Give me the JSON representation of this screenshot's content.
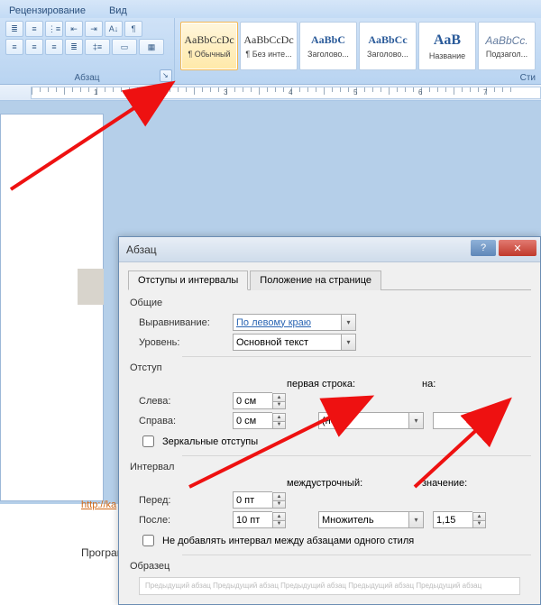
{
  "ribbon": {
    "tabs": {
      "review": "Рецензирование",
      "view": "Вид"
    },
    "paragraph_group_label": "Абзац",
    "styles_label": "Сти",
    "styles": [
      {
        "preview": "AaBbCcDc",
        "name": "¶ Обычный"
      },
      {
        "preview": "AaBbCcDc",
        "name": "¶ Без инте..."
      },
      {
        "preview": "AaBbC",
        "name": "Заголово..."
      },
      {
        "preview": "AaBbCc",
        "name": "Заголово..."
      },
      {
        "preview": "AaB",
        "name": "Название"
      },
      {
        "preview": "AaBbCc.",
        "name": "Подзагол..."
      }
    ]
  },
  "doc": {
    "link": "http://ka",
    "program": "Програм"
  },
  "dialog": {
    "title": "Абзац",
    "help": "?",
    "close": "✕",
    "tab1": "Отступы и интервалы",
    "tab2": "Положение на странице",
    "general_label": "Общие",
    "alignment_label": "Выравнивание:",
    "alignment_value": "По левому краю",
    "level_label": "Уровень:",
    "level_value": "Основной текст",
    "indent_label": "Отступ",
    "left_label": "Слева:",
    "left_value": "0 см",
    "right_label": "Справа:",
    "right_value": "0 см",
    "firstline_label": "первая строка:",
    "firstline_value": "(нет)",
    "on_label": "на:",
    "on_value": "",
    "mirror_label": "Зеркальные отступы",
    "spacing_label": "Интервал",
    "before_label": "Перед:",
    "before_value": "0 пт",
    "after_label": "После:",
    "after_value": "10 пт",
    "linespacing_label": "междустрочный:",
    "linespacing_value": "Множитель",
    "value_label": "значение:",
    "value_value": "1,15",
    "noadd_label": "Не добавлять интервал между абзацами одного стиля",
    "preview_label": "Образец",
    "preview_text": "Предыдущий абзац Предыдущий абзац Предыдущий абзац Предыдущий абзац Предыдущий абзац"
  }
}
